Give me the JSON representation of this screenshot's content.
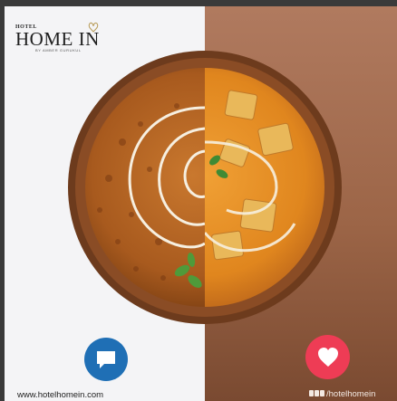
{
  "logo": {
    "hotel_label": "HOTEL",
    "brand_name": "HOME IN",
    "tagline": "BY AMBER GURUKUL"
  },
  "footer": {
    "website": "www.hotelhomein.com",
    "social_handle": "/hotelhomein"
  },
  "colors": {
    "left_background": "#f4f4f6",
    "right_background": "#9c6547",
    "comment_button": "#1f6fb5",
    "like_button": "#ee3c55"
  },
  "icons": {
    "comment": "speech-bubble-icon",
    "like": "heart-icon",
    "social": "social-media-icons"
  }
}
